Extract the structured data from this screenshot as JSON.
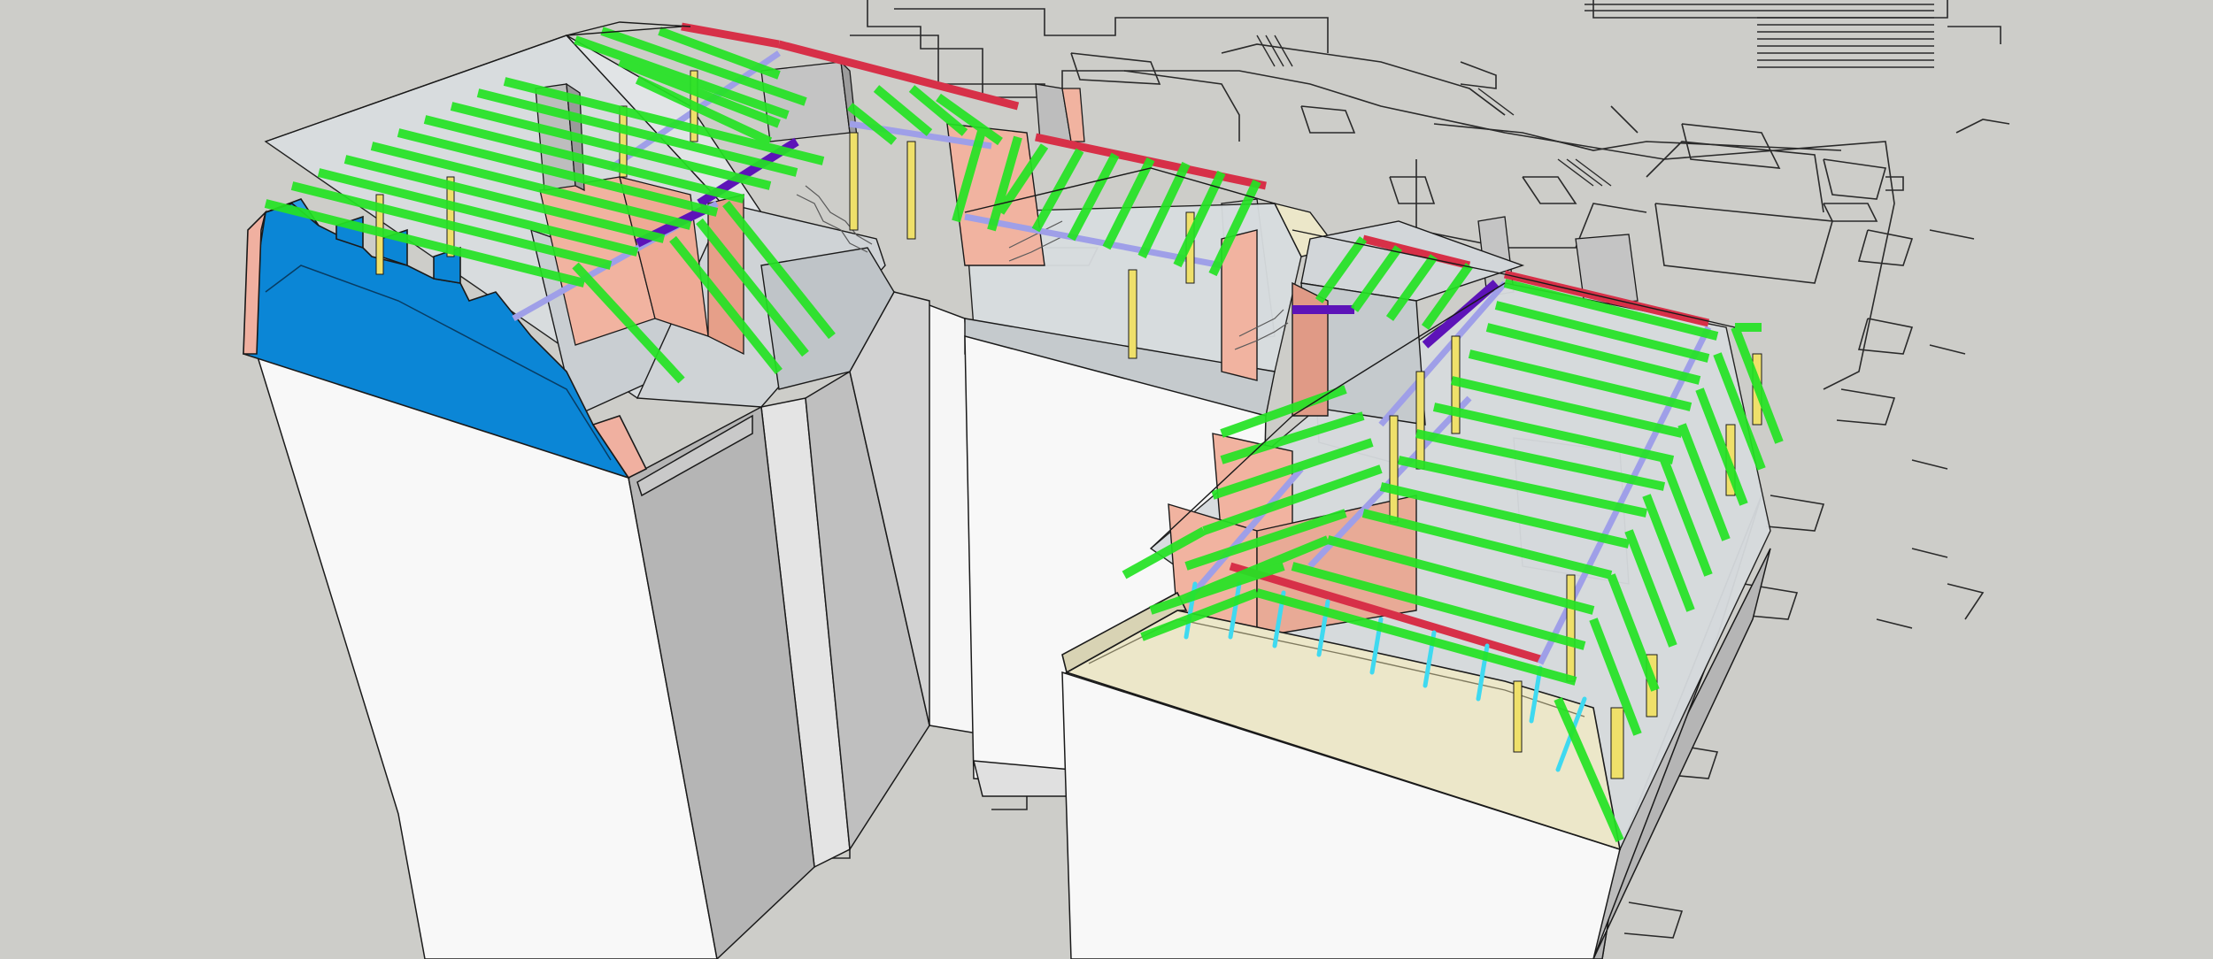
{
  "viewport": {
    "kind": "3d-model-view",
    "background_color": "#cdcdc9"
  },
  "colors": {
    "wall_white": "#f8f8f8",
    "wall_shadow": "#b4b4b4",
    "chimney_gray": "#bdbdbd",
    "gable_blue": "#0b86d6",
    "gable_beige": "#ece7c9",
    "salmon_panel": "#f1b3a0",
    "rafter_green": "#24e324",
    "purlin_lavender": "#9f9fe8",
    "beam_violet": "#5d13b8",
    "wallplate_red": "#d73048",
    "post_yellow": "#efe06a",
    "stud_cyan": "#3fd9f0",
    "glass_tint": "#d8e2e6",
    "floorplan_line": "#2a2a2a",
    "edge_line": "#1a1a1a"
  },
  "elements": [
    "floor-plan-linework",
    "left-wing-building",
    "blue-gable-end-wall",
    "middle-connecting-block",
    "right-wing-building",
    "beige-gable-end-wall",
    "roof-rafters",
    "roof-purlins",
    "ridge-beams",
    "wall-plates",
    "timber-posts",
    "chimney-stacks",
    "interior-stairs"
  ]
}
